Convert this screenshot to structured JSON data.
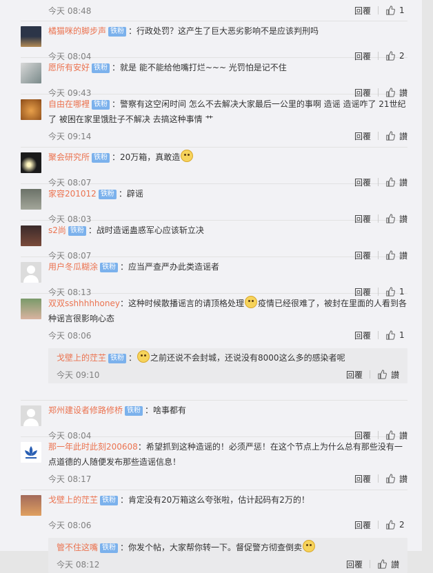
{
  "ui": {
    "reply_label": "回覆",
    "like_label": "讃"
  },
  "comments": [
    {
      "name": "",
      "badge": "",
      "text": "",
      "time": "今天 08:48",
      "likes": "1"
    },
    {
      "name": "橘猫咪的脚步声",
      "badge": "铁粉",
      "text": "：行政处罚？这产生了巨大恶劣影响不是应该判刑吗",
      "time": "今天 08:04",
      "likes": "2"
    },
    {
      "name": "愿所有安好",
      "badge": "铁粉",
      "text": "：就是 能不能给他嘴打烂~~~ 光罚怕是记不住",
      "time": "今天 09:43",
      "likes": "讃"
    },
    {
      "name": "自由在哪裡",
      "badge": "铁粉",
      "text": "：警察有这空闲时间 怎么不去解决大家最后一公里的事啊 造谣 造谣咋了 21世纪了 被困在家里饿肚子不解决 去搞这种事情 艹",
      "time": "今天 09:14",
      "likes": "讃"
    },
    {
      "name": "聚会研究所",
      "badge": "铁粉",
      "text": "：20万箱，真敢造",
      "time": "今天 08:07",
      "likes": "讃"
    },
    {
      "name": "家容201012",
      "badge": "铁粉",
      "text": "：辟谣",
      "time": "今天 08:03",
      "likes": "讃"
    },
    {
      "name": "s2尚",
      "badge": "铁粉",
      "text": "：战时造谣蛊惑军心应该斩立决",
      "time": "今天 08:07",
      "likes": "讃"
    },
    {
      "name": "用户冬瓜糊涂",
      "badge": "铁粉",
      "text": "：应当严查严办此类造谣者",
      "time": "今天 08:13",
      "likes": "1"
    },
    {
      "name": "双双sshhhhhoney",
      "badge": "",
      "text": "：这种时候散播谣言的请顶格处理",
      "text2": "疫情已经很难了，被封在里面的人看到各种谣言很影响心态",
      "time": "今天 08:06",
      "likes": "1",
      "reply": {
        "name": "戈壁上的茳芏",
        "badge": "铁粉",
        "text": "之前还说不会封城，还说没有8000这么多的感染者呢",
        "time": "今天 09:10",
        "likes": "讃"
      }
    },
    {
      "name": "郑州建设者修路修桥",
      "badge": "铁粉",
      "text": "：啥事都有",
      "time": "今天 08:04",
      "likes": "讃"
    },
    {
      "name": "那一年此时此刻200608",
      "badge": "",
      "text": "：希望抓到这种造谣的！必须严惩！在这个节点上为什么总有那些没有一点道德的人随便发布那些造谣信息！",
      "time": "今天 08:17",
      "likes": "讃"
    },
    {
      "name": "戈壁上的茳芏",
      "badge": "铁粉",
      "text": "：肯定没有20万箱这么夸张啦，估计起码有2万的！",
      "time": "今天 08:06",
      "likes": "2",
      "reply": {
        "name": "管不住这嘴",
        "badge": "铁粉",
        "text": "：你发个帖，大家帮你转一下。督促警方彻查倒卖",
        "time": "今天 08:12",
        "likes": "讃"
      }
    }
  ]
}
